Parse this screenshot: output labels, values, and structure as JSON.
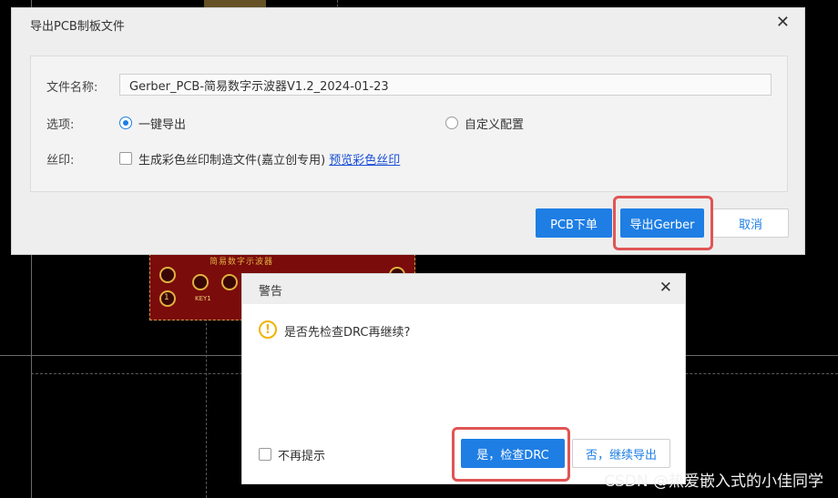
{
  "export_dialog": {
    "title": "导出PCB制板文件",
    "close_icon": "close-icon",
    "filename_label": "文件名称:",
    "filename_value": "Gerber_PCB-简易数字示波器V1.2_2024-01-23",
    "options_label": "选项:",
    "option_one_click": "一键导出",
    "option_one_click_selected": true,
    "option_custom": "自定义配置",
    "option_custom_selected": false,
    "silkscreen_label": "丝印:",
    "silkscreen_checkbox": "生成彩色丝印制造文件(嘉立创专用)",
    "silkscreen_checked": false,
    "silkscreen_preview_link": "预览彩色丝印",
    "btn_pcb_order": "PCB下单",
    "btn_export_gerber": "导出Gerber",
    "btn_cancel": "取消"
  },
  "warning_dialog": {
    "title": "警告",
    "close_icon": "close-icon",
    "warning_icon": "warning-icon",
    "message": "是否先检查DRC再继续?",
    "dont_show_again": "不再提示",
    "dont_show_again_checked": false,
    "btn_check_drc": "是，检查DRC",
    "btn_continue_export": "否，继续导出"
  },
  "background": {
    "pcb_title": "简易数字示波器",
    "pcb_key_label": "KEY1",
    "pcb_pad_number": "1"
  },
  "watermark": "CSDN @热爱嵌入式的小佳同学",
  "colors": {
    "accent": "#1e7ee4",
    "highlight": "#e05555",
    "warning": "#f0b400",
    "canvas": "#000000",
    "pcb": "#7a0c0c"
  }
}
